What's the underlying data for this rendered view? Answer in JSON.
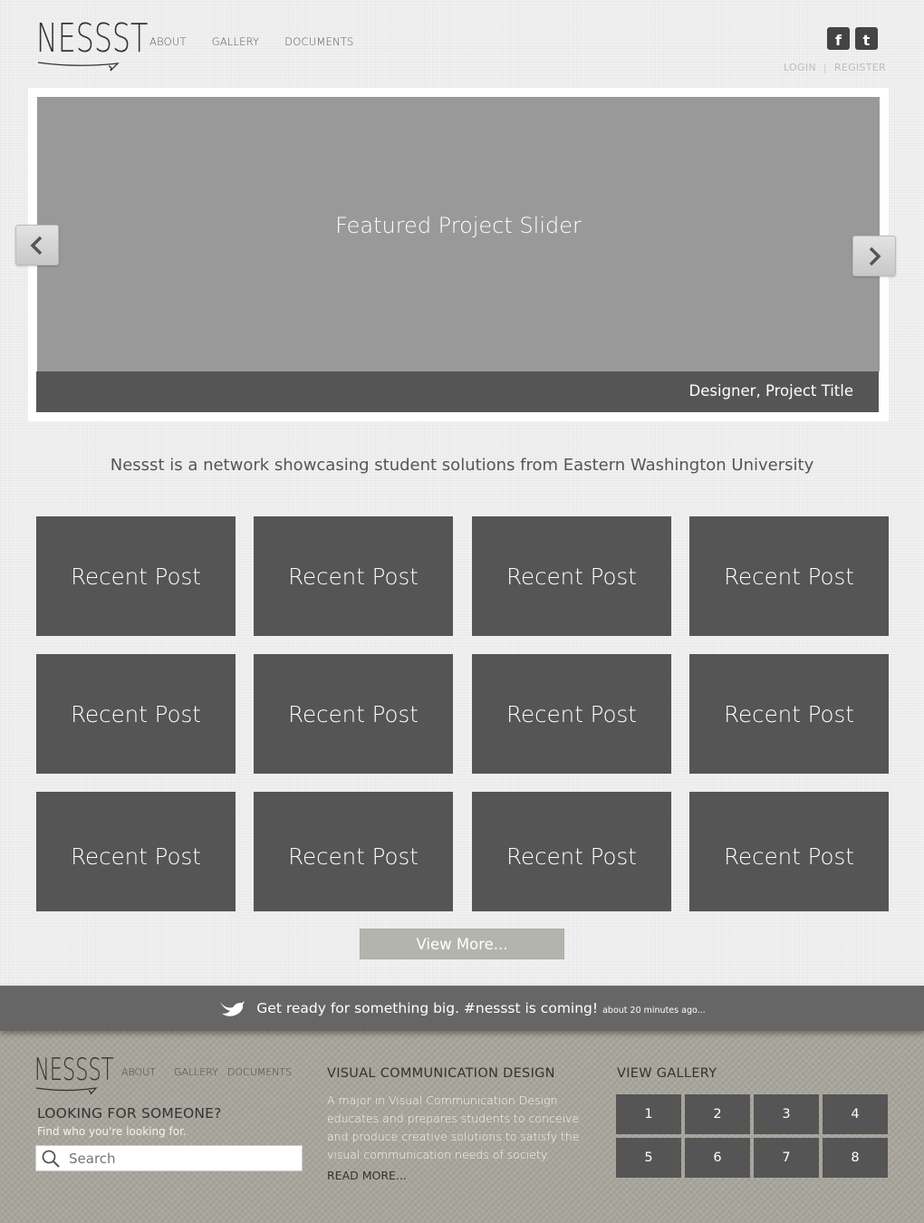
{
  "header": {
    "logo_text": "NESSST",
    "nav": [
      "ABOUT",
      "GALLERY",
      "DOCUMENTS"
    ],
    "social": [
      "f",
      "t"
    ],
    "login": "LOGIN",
    "separator": "|",
    "register": "REGISTER"
  },
  "slider": {
    "title": "Featured Project Slider",
    "caption": "Designer, Project Title"
  },
  "tagline": "Nessst is a network showcasing student solutions from Eastern Washington University",
  "posts": [
    "Recent Post",
    "Recent Post",
    "Recent Post",
    "Recent Post",
    "Recent Post",
    "Recent Post",
    "Recent Post",
    "Recent Post",
    "Recent Post",
    "Recent Post",
    "Recent Post",
    "Recent Post"
  ],
  "view_more": "View More...",
  "tweet": {
    "text": "Get ready for something big. #nessst is coming!",
    "time": "about 20 minutes ago..."
  },
  "footer": {
    "logo_text": "NESSST",
    "nav": [
      "ABOUT",
      "GALLERY",
      "DOCUMENTS"
    ],
    "looking_title": "LOOKING FOR SOMEONE?",
    "looking_sub": "Find who you're looking for.",
    "search_placeholder": "Search",
    "vcd_title": "VISUAL COMMUNICATION DESIGN",
    "vcd_body": "A major in Visual Communication Design educates and prepares students to conceive and produce creative solutions to satisfy the visual communication needs of society.",
    "vcd_more": "READ MORE...",
    "gallery_title": "VIEW GALLERY",
    "gallery_pages": [
      "1",
      "2",
      "3",
      "4",
      "5",
      "6",
      "7",
      "8"
    ]
  }
}
